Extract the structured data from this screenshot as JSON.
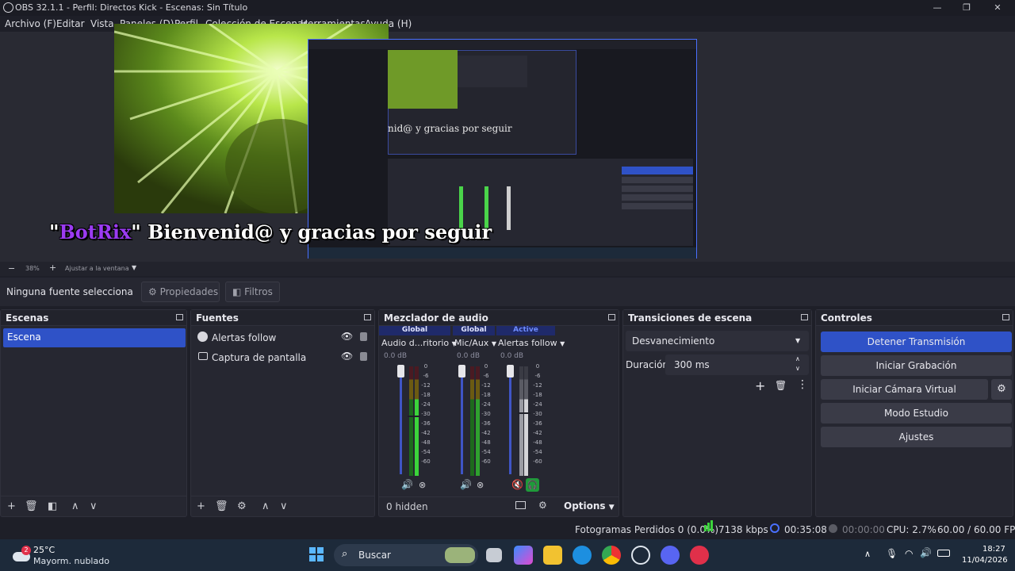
{
  "window": {
    "title": "OBS 32.1.1 - Perfil: Directos Kick - Escenas: Sin Título",
    "minimize": "—",
    "maximize": "❐",
    "close": "✕"
  },
  "menu": [
    "Archivo (F)",
    "Editar",
    "Vista",
    "Paneles (D)",
    "Perfil",
    "Colección de Escenas",
    "Herramientas",
    "Ayuda (H)"
  ],
  "preview": {
    "overlay_text_open": "\"",
    "overlay_brand": "BotRix",
    "overlay_text_rest": "\" Bienvenid@ y gracias por seguir",
    "nested_text": "nid@ y gracias por seguir"
  },
  "zoombar": {
    "minus": "−",
    "zoom": "38%",
    "plus": "+",
    "fit": "Ajustar a la ventana"
  },
  "source_toolbar": {
    "no_source": "Ninguna fuente selecciona",
    "properties": "Propiedades",
    "filters": "Filtros"
  },
  "scenes": {
    "title": "Escenas",
    "items": [
      "Escena"
    ]
  },
  "sources": {
    "title": "Fuentes",
    "items": [
      {
        "name": "Alertas follow",
        "icon": "globe-icon"
      },
      {
        "name": "Captura de pantalla",
        "icon": "monitor-icon"
      }
    ]
  },
  "mixer": {
    "title": "Mezclador de audio",
    "channels": [
      {
        "tag": "Global",
        "name": "Audio d...ritorio",
        "db": "0.0 dB",
        "level": 0.72,
        "muted": false
      },
      {
        "tag": "Global",
        "name": "Mic/Aux",
        "db": "0.0 dB",
        "level": 0.7,
        "muted": false
      },
      {
        "tag": "Active",
        "name": "Alertas follow",
        "db": "0.0 dB",
        "level": 0.7,
        "muted": true
      }
    ],
    "scale": [
      "0",
      "-6",
      "-12",
      "-18",
      "-24",
      "-30",
      "-36",
      "-42",
      "-48",
      "-54",
      "-60"
    ],
    "hidden": "0 hidden",
    "options": "Options"
  },
  "transitions": {
    "title": "Transiciones de escena",
    "selected": "Desvanecimiento",
    "duration_label": "Duración",
    "duration_value": "300 ms"
  },
  "controls": {
    "title": "Controles",
    "stream": "Detener Transmisión",
    "record": "Iniciar Grabación",
    "vcam": "Iniciar Cámara Virtual",
    "studio": "Modo Estudio",
    "settings": "Ajustes",
    "accent": "#2f52c7"
  },
  "status": {
    "dropped": "Fotogramas Perdidos 0 (0.0%)",
    "bitrate": "7138 kbps",
    "stream_time": "00:35:08",
    "rec_time": "00:00:00",
    "cpu": "CPU: 2.7%",
    "fps": "60.00 / 60.00 FPS"
  },
  "taskbar": {
    "weather_badge": "2",
    "temp": "25°C",
    "weather": "Mayorm. nublado",
    "search": "Buscar",
    "time": "18:27",
    "date": "11/04/2026"
  }
}
